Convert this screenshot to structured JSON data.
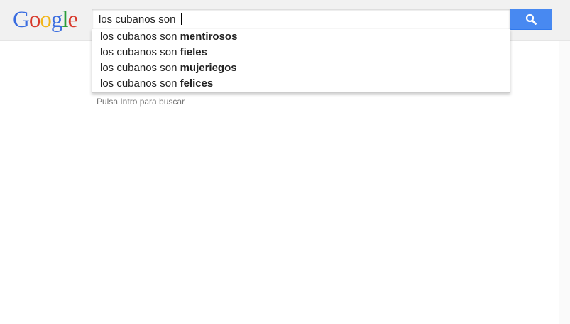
{
  "logo": {
    "letters": [
      "G",
      "o",
      "o",
      "g",
      "l",
      "e"
    ],
    "colors": [
      "#3a6de0",
      "#d8392b",
      "#f2b619",
      "#3a6de0",
      "#2a9d3a",
      "#d8392b"
    ]
  },
  "search": {
    "query": "los cubanos son ",
    "button_icon": "search-icon"
  },
  "suggestions": [
    {
      "prefix": "los cubanos son ",
      "completion": "mentirosos"
    },
    {
      "prefix": "los cubanos son ",
      "completion": "fieles"
    },
    {
      "prefix": "los cubanos son ",
      "completion": "mujeriegos"
    },
    {
      "prefix": "los cubanos son ",
      "completion": "felices"
    }
  ],
  "hint": "Pulsa Intro para buscar"
}
